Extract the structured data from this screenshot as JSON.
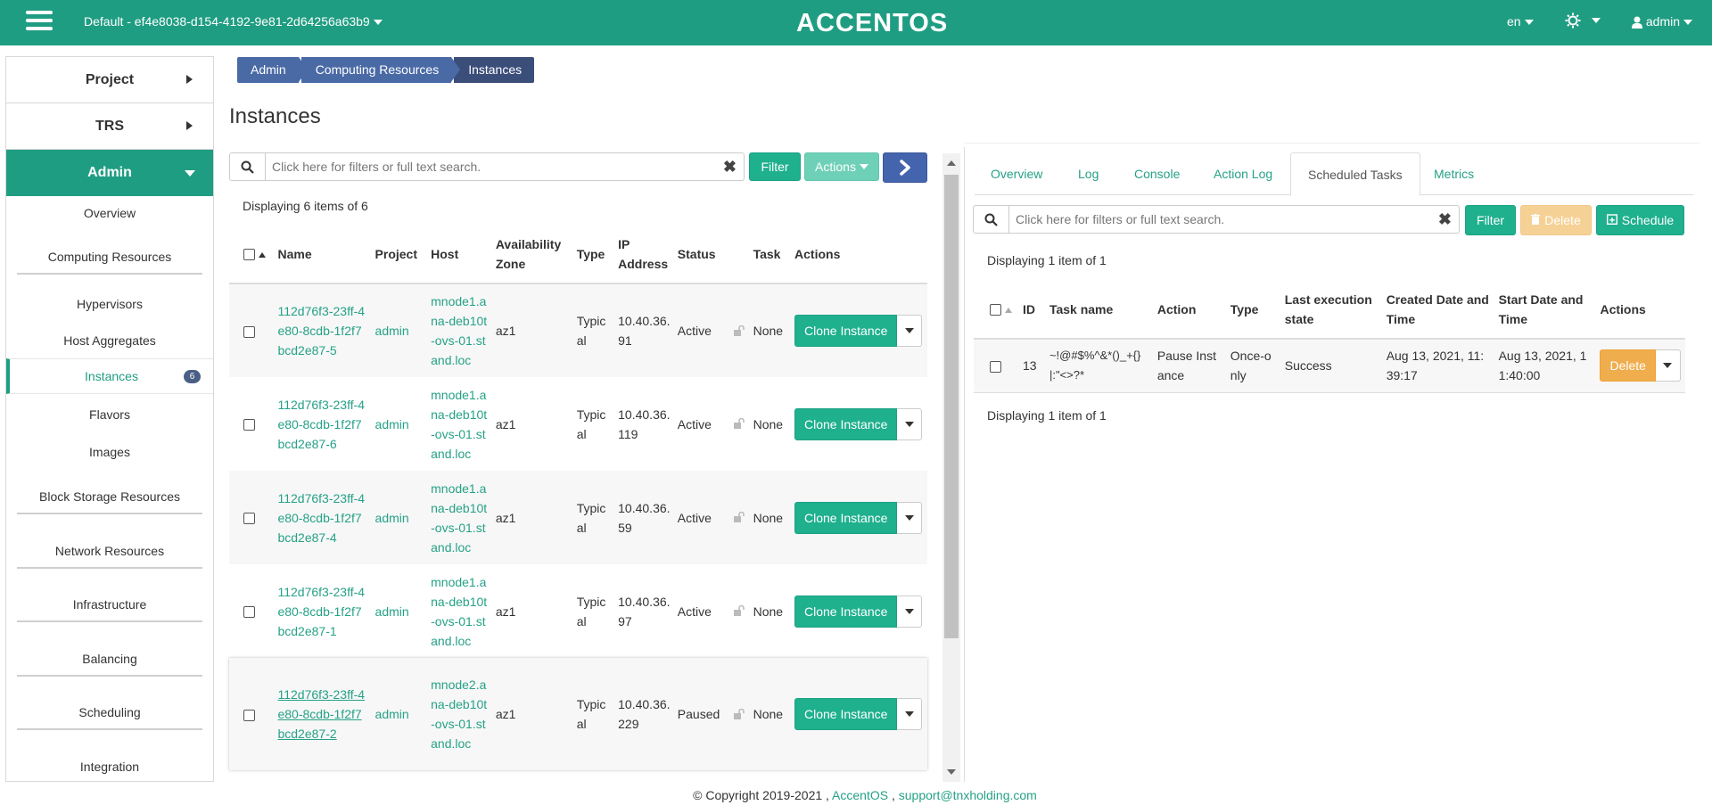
{
  "navbar": {
    "project": "Default - ef4e8038-d154-4192-9e81-2d64256a63b9",
    "logo": "ACCENTOS",
    "language": "en",
    "user": "admin"
  },
  "sidebar": {
    "sections": [
      "Project",
      "TRS",
      "Admin"
    ],
    "items": [
      "Overview",
      "Computing Resources",
      "Hypervisors",
      "Host Aggregates",
      "Instances",
      "Flavors",
      "Images",
      "Block Storage Resources",
      "Network Resources",
      "Infrastructure",
      "Balancing",
      "Scheduling",
      "Integration"
    ],
    "instances_badge": "6"
  },
  "breadcrumb": [
    "Admin",
    "Computing Resources",
    "Instances"
  ],
  "page_title": "Instances",
  "left": {
    "search_placeholder": "Click here for filters or full text search.",
    "filter_label": "Filter",
    "actions_label": "Actions",
    "display_count": "Displaying 6 items of 6",
    "headers": {
      "name": "Name",
      "project": "Project",
      "host": "Host",
      "az": "Availability Zone",
      "type": "Type",
      "ip": "IP Address",
      "status": "Status",
      "task": "Task",
      "actions": "Actions"
    },
    "rows": [
      {
        "name": "112d76f3-23ff-4e80-8cdb-1f2f7bcd2e87-5",
        "project": "admin",
        "host": "mnode1.ana-deb10t-ovs-01.stand.loc",
        "az": "az1",
        "type": "Typical",
        "ip": "10.40.36.91",
        "status": "Active",
        "task": "None",
        "action": "Clone Instance"
      },
      {
        "name": "112d76f3-23ff-4e80-8cdb-1f2f7bcd2e87-6",
        "project": "admin",
        "host": "mnode1.ana-deb10t-ovs-01.stand.loc",
        "az": "az1",
        "type": "Typical",
        "ip": "10.40.36.119",
        "status": "Active",
        "task": "None",
        "action": "Clone Instance"
      },
      {
        "name": "112d76f3-23ff-4e80-8cdb-1f2f7bcd2e87-4",
        "project": "admin",
        "host": "mnode1.ana-deb10t-ovs-01.stand.loc",
        "az": "az1",
        "type": "Typical",
        "ip": "10.40.36.59",
        "status": "Active",
        "task": "None",
        "action": "Clone Instance"
      },
      {
        "name": "112d76f3-23ff-4e80-8cdb-1f2f7bcd2e87-1",
        "project": "admin",
        "host": "mnode1.ana-deb10t-ovs-01.stand.loc",
        "az": "az1",
        "type": "Typical",
        "ip": "10.40.36.97",
        "status": "Active",
        "task": "None",
        "action": "Clone Instance"
      },
      {
        "name": "112d76f3-23ff-4e80-8cdb-1f2f7bcd2e87-2",
        "project": "admin",
        "host": "mnode2.ana-deb10t-ovs-01.stand.loc",
        "az": "az1",
        "type": "Typical",
        "ip": "10.40.36.229",
        "status": "Paused",
        "task": "None",
        "action": "Clone Instance"
      }
    ]
  },
  "right": {
    "tabs": [
      "Overview",
      "Log",
      "Console",
      "Action Log",
      "Scheduled Tasks",
      "Metrics"
    ],
    "search_placeholder": "Click here for filters or full text search.",
    "filter_label": "Filter",
    "delete_label": "Delete",
    "schedule_label": "Schedule",
    "display_count": "Displaying 1 item of 1",
    "display_count_bottom": "Displaying 1 item of 1",
    "headers": {
      "id": "ID",
      "task_name": "Task name",
      "action": "Action",
      "type": "Type",
      "last_state": "Last execution state",
      "created": "Created Date and Time",
      "start": "Start Date and Time",
      "actions": "Actions"
    },
    "row": {
      "id": "13",
      "task_name": "~!@#$%^&*()_+{}|:\"<>?*",
      "action": "Pause Instance",
      "type": "Once-only",
      "last_state": "Success",
      "created": "Aug 13, 2021, 11:39:17",
      "start": "Aug 13, 2021, 11:40:00",
      "button": "Delete"
    }
  },
  "footer": {
    "copyright": "© Copyright 2019-2021 ,",
    "brand": "AccentOS",
    "sep": ",",
    "email": "support@tnxholding.com"
  }
}
